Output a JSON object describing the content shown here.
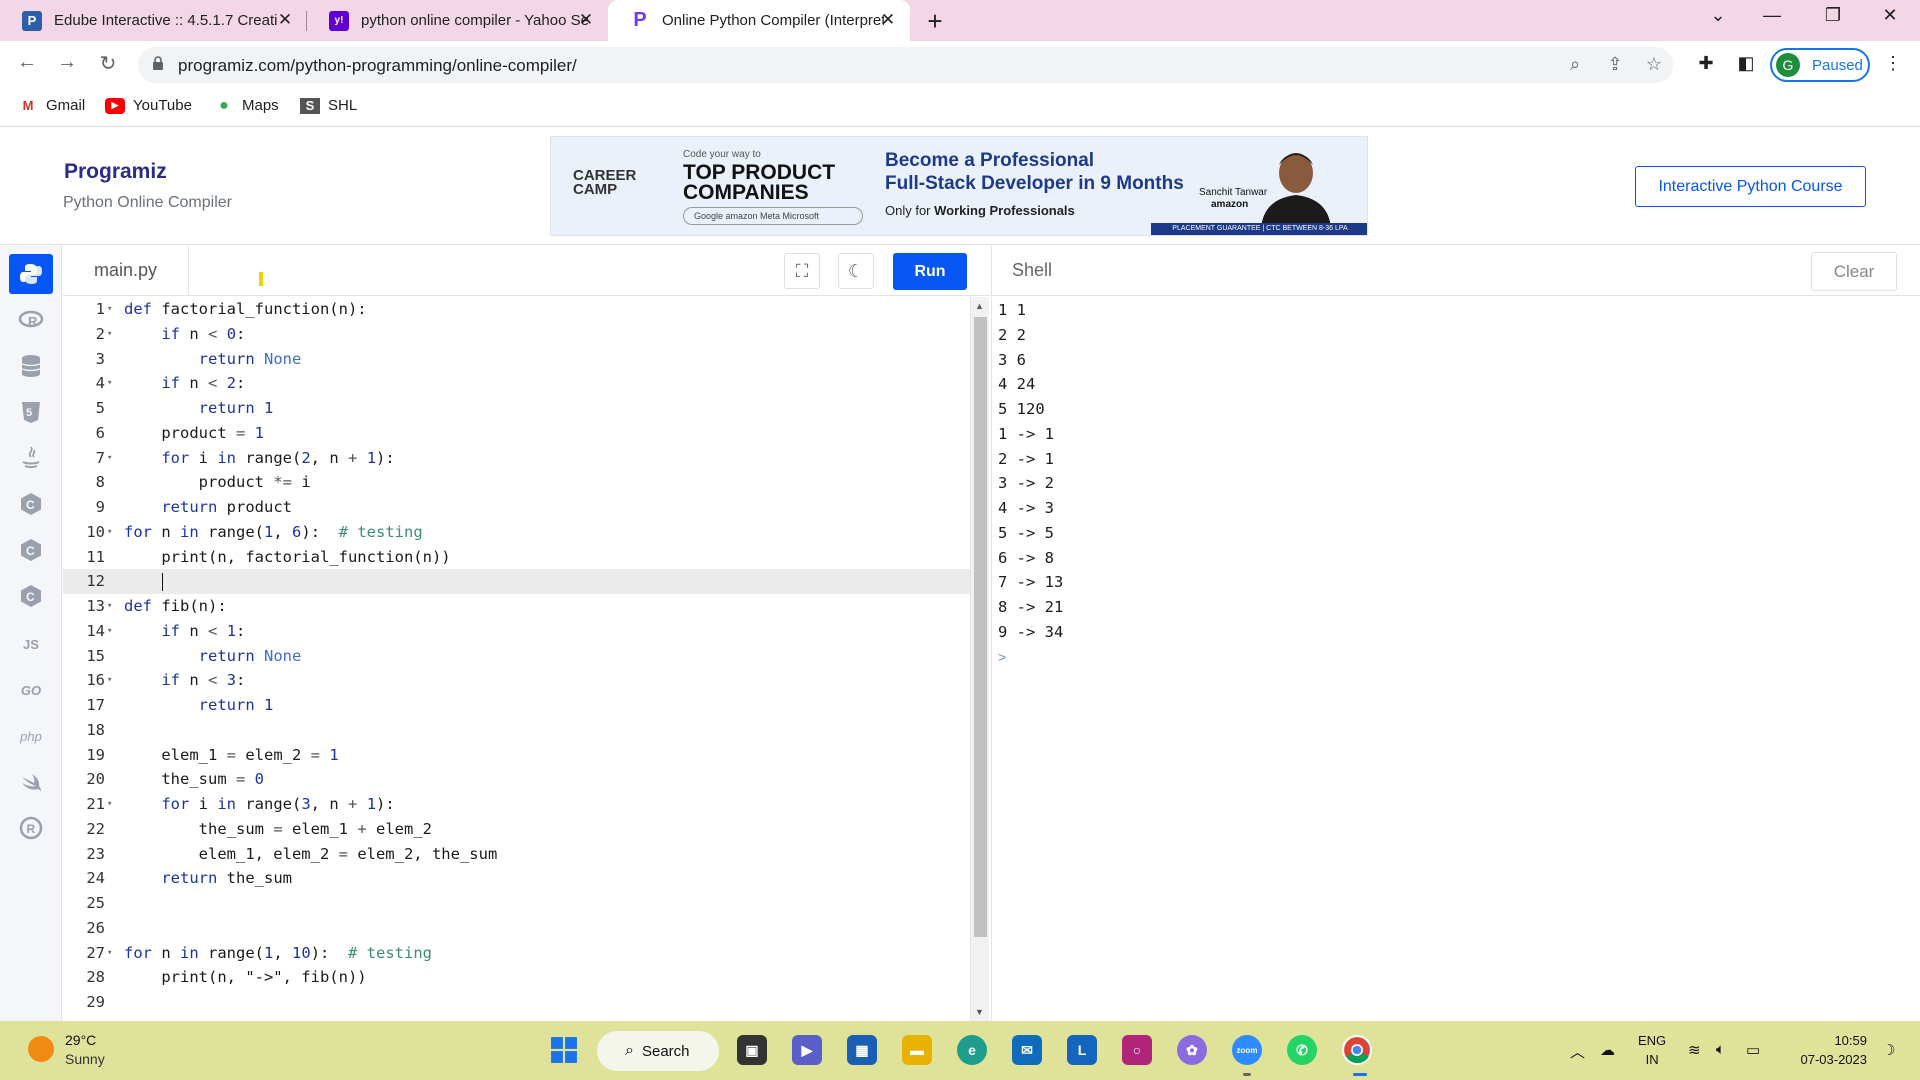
{
  "browser": {
    "tabs": [
      {
        "title": "Edube Interactive :: 4.5.1.7 Creati",
        "favicon": "edube-icon",
        "color": "#2c5fa8",
        "glyph": "P"
      },
      {
        "title": "python online compiler - Yahoo Se",
        "favicon": "yahoo-icon",
        "color": "#6001d2",
        "glyph": "y!"
      },
      {
        "title": "Online Python Compiler (Interpret",
        "favicon": "programiz-icon",
        "color": "#6a3cf5",
        "glyph": "P"
      }
    ],
    "url": "programiz.com/python-programming/online-compiler/",
    "profile_initial": "G",
    "profile_label": "Paused",
    "bookmarks": [
      {
        "label": "Gmail",
        "icon": "gmail-icon"
      },
      {
        "label": "YouTube",
        "icon": "youtube-icon"
      },
      {
        "label": "Maps",
        "icon": "maps-icon"
      },
      {
        "label": "SHL",
        "icon": "shl-icon"
      }
    ]
  },
  "site": {
    "logo": "Programiz",
    "subtitle": "Python Online Compiler",
    "course_button": "Interactive Python Course",
    "ad": {
      "brand": "CAREER CAMP",
      "tagline_small": "Code your way to",
      "headline": "TOP PRODUCT COMPANIES",
      "company_logos": "Google  amazon  Meta  Microsoft",
      "title_line1": "Become a Professional",
      "title_line2": "Full-Stack Developer in 9 Months",
      "audience_prefix": "Only for",
      "audience": "Working Professionals",
      "person_name": "Sanchit Tanwar",
      "person_company": "amazon",
      "footer": "PLACEMENT GUARANTEE | CTC BETWEEN 8-36 LPA"
    }
  },
  "editor": {
    "filename": "main.py",
    "run_label": "Run",
    "current_line": 12,
    "lines": [
      "def factorial_function(n):",
      "    if n < 0:",
      "        return None",
      "    if n < 2:",
      "        return 1",
      "    product = 1",
      "    for i in range(2, n + 1):",
      "        product *= i",
      "    return product",
      "for n in range(1, 6):  # testing",
      "    print(n, factorial_function(n))",
      "",
      "def fib(n):",
      "    if n < 1:",
      "        return None",
      "    if n < 3:",
      "        return 1",
      "",
      "    elem_1 = elem_2 = 1",
      "    the_sum = 0",
      "    for i in range(3, n + 1):",
      "        the_sum = elem_1 + elem_2",
      "        elem_1, elem_2 = elem_2, the_sum",
      "    return the_sum",
      "",
      "",
      "for n in range(1, 10):  # testing",
      "    print(n, \"->\", fib(n))",
      ""
    ],
    "fold_lines": [
      1,
      2,
      4,
      7,
      10,
      13,
      14,
      16,
      21,
      27
    ]
  },
  "shell": {
    "title": "Shell",
    "clear_label": "Clear",
    "output": [
      "1 1",
      "2 2",
      "3 6",
      "4 24",
      "5 120",
      "1 -> 1",
      "2 -> 1",
      "3 -> 2",
      "4 -> 3",
      "5 -> 5",
      "6 -> 8",
      "7 -> 13",
      "8 -> 21",
      "9 -> 34"
    ],
    "prompt": ">"
  },
  "taskbar": {
    "temperature": "29°C",
    "weather": "Sunny",
    "search_label": "Search",
    "language_line1": "ENG",
    "language_line2": "IN",
    "time": "10:59",
    "date": "07-03-2023"
  }
}
